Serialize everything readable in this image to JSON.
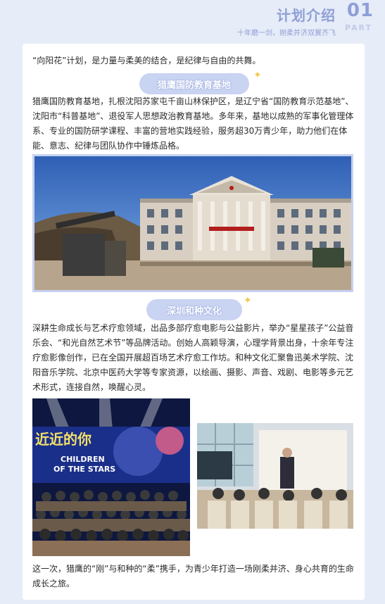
{
  "header": {
    "title": "计划介绍",
    "subtitle": "十年磨一剑，刚柔并济双翼齐飞",
    "part_number": "01",
    "part_label": "PART"
  },
  "intro_text": "“向阳花”计划，是力量与柔美的结合，是纪律与自由的共舞。",
  "section1": {
    "heading": "猎鹰国防教育基地",
    "body": "猎鹰国防教育基地，扎根沈阳苏家屯千亩山林保护区，是辽宁省“国防教育示范基地”、沈阳市“科普基地”、退役军人思想政治教育基地。多年来，基地以成熟的军事化管理体系、专业的国防研学课程、丰富的营地实践经验，服务超30万青少年，助力他们在体能、意志、纪律与团队协作中锤炼品格。"
  },
  "section2": {
    "heading": "深圳和种文化",
    "body": "深耕生命成长与艺术疗愈领域，出品多部疗愈电影与公益影片，举办“星星孩子”公益音乐会、“和光自然艺术节”等品牌活动。创始人高颖导演，心理学背景出身，十余年专注疗愈影像创作，已在全国开展超百场艺术疗愈工作坊。和种文化汇聚鲁迅美术学院、沈阳音乐学院、北京中医药大学等专家资源，以绘画、摄影、声音、戏剧、电影等多元艺术形式，连接自然，唤醒心灵。"
  },
  "photo_texts": {
    "stage_banner_cn": "近近的你",
    "stage_banner_en1": "CHILDREN",
    "stage_banner_en2": "OF THE STARS"
  },
  "closing_text": "这一次，猎鹰的“刚”与和种的“柔”携手，为青少年打造一场刚柔并济、身心共育的生命成长之旅。",
  "colors": {
    "page_bg": "#e6ecf8",
    "accent": "#8f9fd6",
    "pill": "#c9d3f2",
    "sparkle": "#f0c94a"
  }
}
